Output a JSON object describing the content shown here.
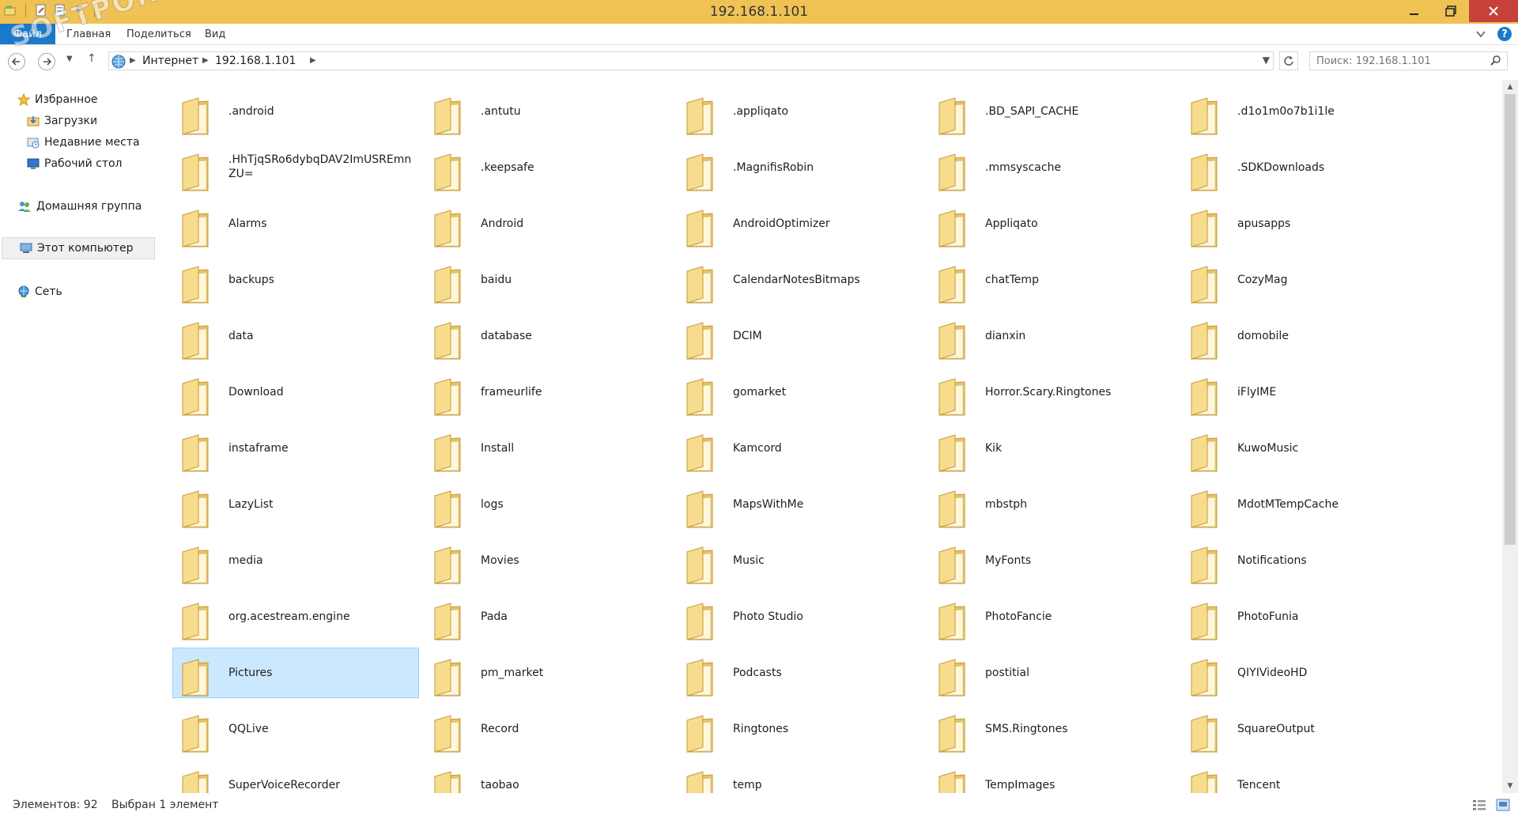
{
  "window": {
    "title": "192.168.1.101"
  },
  "ribbon": {
    "tabs": [
      {
        "label": "Файл"
      },
      {
        "label": "Главная"
      },
      {
        "label": "Поделиться"
      },
      {
        "label": "Вид"
      }
    ]
  },
  "navigation": {
    "breadcrumbs": [
      {
        "label": "Интернет"
      },
      {
        "label": "192.168.1.101"
      }
    ],
    "up_label": "↑"
  },
  "search": {
    "placeholder": "Поиск: 192.168.1.101"
  },
  "sidebar": {
    "items": [
      {
        "label": "Избранное",
        "icon": "star-icon"
      },
      {
        "label": "Загрузки",
        "icon": "downloads-icon"
      },
      {
        "label": "Недавние места",
        "icon": "recent-places-icon"
      },
      {
        "label": "Рабочий стол",
        "icon": "desktop-icon"
      },
      {
        "label": "Домашняя группа",
        "icon": "homegroup-icon"
      },
      {
        "label": "Этот компьютер",
        "icon": "computer-icon"
      },
      {
        "label": "Сеть",
        "icon": "network-icon"
      }
    ]
  },
  "folders": [
    {
      "name": ".android"
    },
    {
      "name": ".antutu"
    },
    {
      "name": ".appliqato"
    },
    {
      "name": ".BD_SAPI_CACHE"
    },
    {
      "name": ".d1o1m0o7b1i1le"
    },
    {
      "name": ".HhTjqSRo6dybqDAV2ImUSREmnZU="
    },
    {
      "name": ".keepsafe"
    },
    {
      "name": ".MagnifisRobin"
    },
    {
      "name": ".mmsyscache"
    },
    {
      "name": ".SDKDownloads"
    },
    {
      "name": "Alarms"
    },
    {
      "name": "Android"
    },
    {
      "name": "AndroidOptimizer"
    },
    {
      "name": "Appliqato"
    },
    {
      "name": "apusapps"
    },
    {
      "name": "backups"
    },
    {
      "name": "baidu"
    },
    {
      "name": "CalendarNotesBitmaps"
    },
    {
      "name": "chatTemp"
    },
    {
      "name": "CozyMag"
    },
    {
      "name": "data"
    },
    {
      "name": "database"
    },
    {
      "name": "DCIM"
    },
    {
      "name": "dianxin"
    },
    {
      "name": "domobile"
    },
    {
      "name": "Download"
    },
    {
      "name": "frameurlife"
    },
    {
      "name": "gomarket"
    },
    {
      "name": "Horror.Scary.Ringtones"
    },
    {
      "name": "iFlyIME"
    },
    {
      "name": "instaframe"
    },
    {
      "name": "Install"
    },
    {
      "name": "Kamcord"
    },
    {
      "name": "Kik"
    },
    {
      "name": "KuwoMusic"
    },
    {
      "name": "LazyList"
    },
    {
      "name": "logs"
    },
    {
      "name": "MapsWithMe"
    },
    {
      "name": "mbstph"
    },
    {
      "name": "MdotMTempCache"
    },
    {
      "name": "media"
    },
    {
      "name": "Movies"
    },
    {
      "name": "Music"
    },
    {
      "name": "MyFonts"
    },
    {
      "name": "Notifications"
    },
    {
      "name": "org.acestream.engine"
    },
    {
      "name": "Pada"
    },
    {
      "name": "Photo Studio"
    },
    {
      "name": "PhotoFancie"
    },
    {
      "name": "PhotoFunia"
    },
    {
      "name": "Pictures",
      "selected": true
    },
    {
      "name": "pm_market"
    },
    {
      "name": "Podcasts"
    },
    {
      "name": "postitial"
    },
    {
      "name": "QIYIVideoHD"
    },
    {
      "name": "QQLive"
    },
    {
      "name": "Record"
    },
    {
      "name": "Ringtones"
    },
    {
      "name": "SMS.Ringtones"
    },
    {
      "name": "SquareOutput"
    },
    {
      "name": "SuperVoiceRecorder"
    },
    {
      "name": "taobao"
    },
    {
      "name": "temp"
    },
    {
      "name": "TempImages"
    },
    {
      "name": "Tencent"
    }
  ],
  "status": {
    "count": "Элементов: 92",
    "selected": "Выбран 1 элемент"
  },
  "watermark": "SOFTPORTAL",
  "colors": {
    "title_bar": "#f0c254",
    "file_tab": "#1979ca",
    "close_button": "#c7413b",
    "selection": "#cce8ff"
  }
}
